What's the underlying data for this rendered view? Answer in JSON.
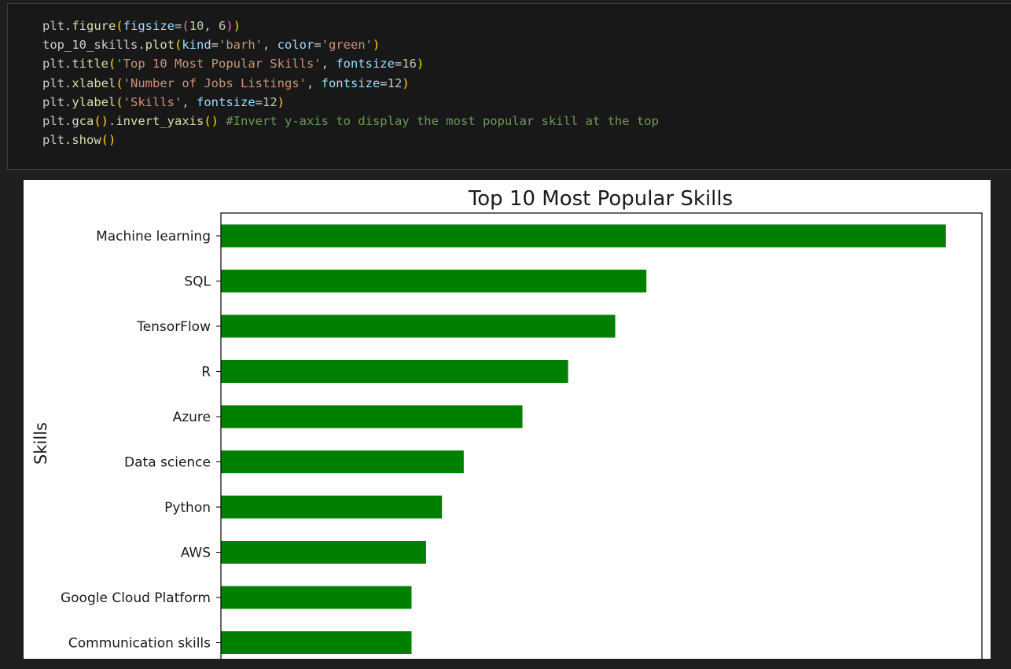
{
  "code_cell": {
    "lines": [
      [
        {
          "t": "plt.",
          "c": "default"
        },
        {
          "t": "figure",
          "c": "fn"
        },
        {
          "t": "(",
          "c": "b1"
        },
        {
          "t": "figsize",
          "c": "param"
        },
        {
          "t": "=",
          "c": "default"
        },
        {
          "t": "(",
          "c": "b2"
        },
        {
          "t": "10",
          "c": "num"
        },
        {
          "t": ", ",
          "c": "default"
        },
        {
          "t": "6",
          "c": "num"
        },
        {
          "t": ")",
          "c": "b2"
        },
        {
          "t": ")",
          "c": "b1"
        }
      ],
      [
        {
          "t": "top_10_skills.",
          "c": "default"
        },
        {
          "t": "plot",
          "c": "fn"
        },
        {
          "t": "(",
          "c": "b1"
        },
        {
          "t": "kind",
          "c": "param"
        },
        {
          "t": "=",
          "c": "default"
        },
        {
          "t": "'barh'",
          "c": "str"
        },
        {
          "t": ", ",
          "c": "default"
        },
        {
          "t": "color",
          "c": "param"
        },
        {
          "t": "=",
          "c": "default"
        },
        {
          "t": "'green'",
          "c": "str"
        },
        {
          "t": ")",
          "c": "b1"
        }
      ],
      [
        {
          "t": "plt.",
          "c": "default"
        },
        {
          "t": "title",
          "c": "fn"
        },
        {
          "t": "(",
          "c": "b1"
        },
        {
          "t": "'Top 10 Most Popular Skills'",
          "c": "str"
        },
        {
          "t": ", ",
          "c": "default"
        },
        {
          "t": "fontsize",
          "c": "param"
        },
        {
          "t": "=",
          "c": "default"
        },
        {
          "t": "16",
          "c": "num"
        },
        {
          "t": ")",
          "c": "b1"
        }
      ],
      [
        {
          "t": "plt.",
          "c": "default"
        },
        {
          "t": "xlabel",
          "c": "fn"
        },
        {
          "t": "(",
          "c": "b1"
        },
        {
          "t": "'Number of Jobs Listings'",
          "c": "str"
        },
        {
          "t": ", ",
          "c": "default"
        },
        {
          "t": "fontsize",
          "c": "param"
        },
        {
          "t": "=",
          "c": "default"
        },
        {
          "t": "12",
          "c": "num"
        },
        {
          "t": ")",
          "c": "b1"
        }
      ],
      [
        {
          "t": "plt.",
          "c": "default"
        },
        {
          "t": "ylabel",
          "c": "fn"
        },
        {
          "t": "(",
          "c": "b1"
        },
        {
          "t": "'Skills'",
          "c": "str"
        },
        {
          "t": ", ",
          "c": "default"
        },
        {
          "t": "fontsize",
          "c": "param"
        },
        {
          "t": "=",
          "c": "default"
        },
        {
          "t": "12",
          "c": "num"
        },
        {
          "t": ")",
          "c": "b1"
        }
      ],
      [
        {
          "t": "plt.",
          "c": "default"
        },
        {
          "t": "gca",
          "c": "fn"
        },
        {
          "t": "()",
          "c": "b1"
        },
        {
          "t": ".",
          "c": "default"
        },
        {
          "t": "invert_yaxis",
          "c": "fn"
        },
        {
          "t": "()",
          "c": "b1"
        },
        {
          "t": " ",
          "c": "default"
        },
        {
          "t": "#Invert y-axis to display the most popular skill at the top",
          "c": "comment"
        }
      ],
      [
        {
          "t": "plt.",
          "c": "default"
        },
        {
          "t": "show",
          "c": "fn"
        },
        {
          "t": "()",
          "c": "b1"
        }
      ]
    ]
  },
  "colors": {
    "default": "#cccccc",
    "fn": "#dcdcaa",
    "param": "#9cdcfe",
    "str": "#ce9178",
    "num": "#b5cea8",
    "b1": "#ffd700",
    "b2": "#da70d6",
    "comment": "#6a9955",
    "bar": "#008000"
  },
  "chart_data": {
    "type": "bar",
    "orientation": "horizontal",
    "title": "Top 10 Most Popular Skills",
    "ylabel": "Skills",
    "categories": [
      "Machine learning",
      "SQL",
      "TensorFlow",
      "R",
      "Azure",
      "Data science",
      "Python",
      "AWS",
      "Google Cloud Platform",
      "Communication skills"
    ],
    "values": [
      100,
      58.7,
      54.4,
      47.9,
      41.6,
      33.5,
      30.5,
      28.3,
      26.3,
      26.3
    ],
    "value_note": "relative bar lengths; x-axis ticks not visible in crop",
    "bar_color": "#008000"
  }
}
